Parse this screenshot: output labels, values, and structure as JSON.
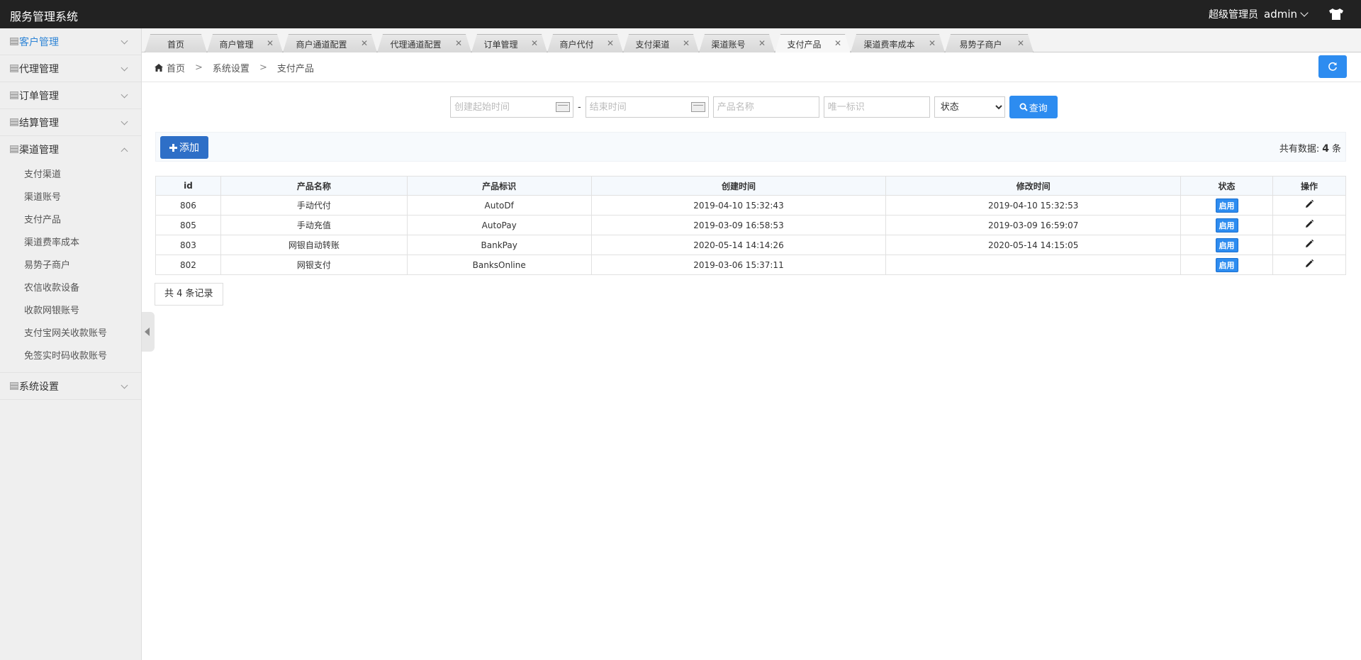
{
  "app": {
    "title": "服务管理系统"
  },
  "header": {
    "role": "超级管理员",
    "username": "admin"
  },
  "sidebar": {
    "groups": [
      {
        "label": "客户管理",
        "active": true,
        "expanded": false
      },
      {
        "label": "代理管理",
        "expanded": false
      },
      {
        "label": "订单管理",
        "expanded": false
      },
      {
        "label": "结算管理",
        "expanded": false
      },
      {
        "label": "渠道管理",
        "expanded": true
      },
      {
        "label": "系统设置",
        "expanded": false
      }
    ],
    "channel_items": [
      "支付渠道",
      "渠道账号",
      "支付产品",
      "渠道费率成本",
      "易势子商户",
      "农信收款设备",
      "收款网银账号",
      "支付宝网关收款账号",
      "免签实时码收款账号"
    ]
  },
  "tabs": [
    {
      "label": "首页"
    },
    {
      "label": "商户管理"
    },
    {
      "label": "商户通道配置"
    },
    {
      "label": "代理通道配置"
    },
    {
      "label": "订单管理"
    },
    {
      "label": "商户代付"
    },
    {
      "label": "支付渠道"
    },
    {
      "label": "渠道账号"
    },
    {
      "label": "支付产品",
      "active": true
    },
    {
      "label": "渠道费率成本"
    },
    {
      "label": "易势子商户"
    }
  ],
  "breadcrumb": {
    "home": "首页",
    "level1": "系统设置",
    "level2": "支付产品"
  },
  "search": {
    "start_placeholder": "创建起始时间",
    "dash": "-",
    "end_placeholder": "结束时间",
    "name_placeholder": "产品名称",
    "code_placeholder": "唯一标识",
    "status_selected": "状态",
    "button": "查询"
  },
  "toolbar": {
    "add": "添加",
    "total_prefix": "共有数据:",
    "total": "4",
    "total_suffix": "条"
  },
  "table": {
    "headers": [
      "id",
      "产品名称",
      "产品标识",
      "创建时间",
      "修改时间",
      "状态",
      "操作"
    ],
    "rows": [
      {
        "id": "806",
        "name": "手动代付",
        "code": "AutoDf",
        "created": "2019-04-10 15:32:43",
        "modified": "2019-04-10 15:32:53",
        "status": "启用"
      },
      {
        "id": "805",
        "name": "手动充值",
        "code": "AutoPay",
        "created": "2019-03-09 16:58:53",
        "modified": "2019-03-09 16:59:07",
        "status": "启用"
      },
      {
        "id": "803",
        "name": "网银自动转账",
        "code": "BankPay",
        "created": "2020-05-14 14:14:26",
        "modified": "2020-05-14 14:15:05",
        "status": "启用"
      },
      {
        "id": "802",
        "name": "网银支付",
        "code": "BanksOnline",
        "created": "2019-03-06 15:37:11",
        "modified": "",
        "status": "启用"
      }
    ]
  },
  "footer": {
    "records": "共 4 条记录"
  },
  "colors": {
    "primary": "#2d8cf0",
    "topbar": "#222222",
    "sidebar": "#efefef",
    "active_menu": "#2f85d6"
  },
  "icons": {
    "home": "home-icon",
    "refresh": "refresh-icon",
    "search": "search-icon",
    "add": "plus-icon",
    "edit": "pencil-icon",
    "theme": "tshirt-icon"
  }
}
